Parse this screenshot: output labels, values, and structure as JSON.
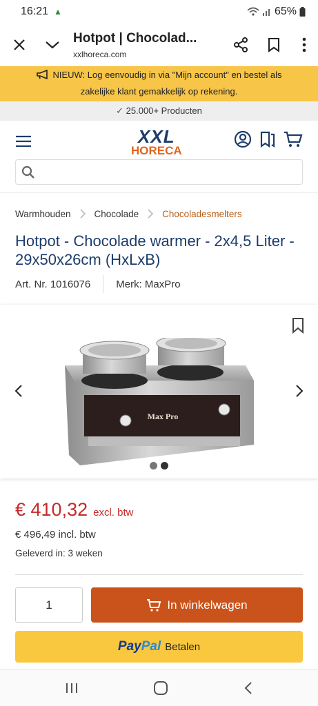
{
  "status": {
    "time": "16:21",
    "battery": "65%"
  },
  "browser": {
    "title": "Hotpot | Chocolad...",
    "domain": "xxlhoreca.com"
  },
  "promo": {
    "line1": "NIEUW: Log eenvoudig in via \"Mijn account\" en bestel als",
    "line2": "zakelijke klant gemakkelijk op rekening."
  },
  "usp": "25.000+ Producten",
  "logo": {
    "top": "XXL",
    "bottom": "HORECA"
  },
  "search": {
    "placeholder": ""
  },
  "breadcrumb": [
    "Warmhouden",
    "Chocolade",
    "Chocoladesmelters"
  ],
  "product": {
    "title": "Hotpot - Chocolade warmer - 2x4,5 Liter - 29x50x26cm (HxLxB)",
    "art_nr": "Art. Nr. 1016076",
    "brand": "Merk: MaxPro",
    "image_label": "Max Pro",
    "image_count": 2,
    "image_current": 2
  },
  "price": {
    "excl_value": "€ 410,32",
    "excl_label": "excl. btw",
    "incl": "€ 496,49 incl. btw",
    "delivery": "Geleverd in: 3 weken"
  },
  "cart": {
    "quantity": "1",
    "add_label": "In winkelwagen"
  },
  "paypal": {
    "brand1": "Pay",
    "brand2": "Pal",
    "label": "Betalen"
  },
  "colors": {
    "accent": "#c9531a",
    "brand_blue": "#1d3c6b",
    "price_red": "#c62a2a",
    "promo_yellow": "#f7c548"
  }
}
